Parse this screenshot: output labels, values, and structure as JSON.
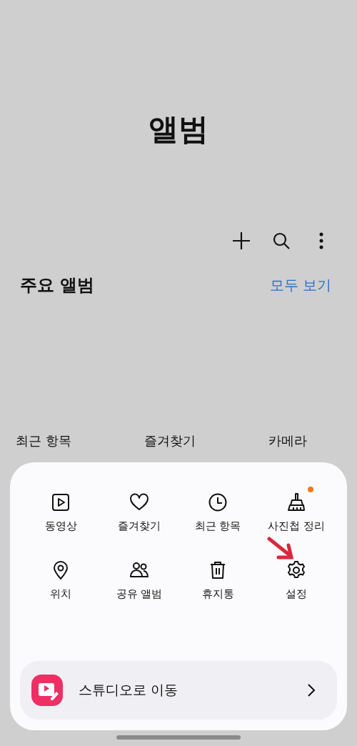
{
  "header": {
    "title": "앨범"
  },
  "toolbar": [
    {
      "kind": "add"
    },
    {
      "kind": "search"
    },
    {
      "kind": "more"
    }
  ],
  "section": {
    "title": "주요 앨범",
    "link": "모두 보기"
  },
  "albums": [
    "최근 항목",
    "즐겨찾기",
    "카메라"
  ],
  "menu": [
    {
      "label": "동영상",
      "kind": "video",
      "badge": false
    },
    {
      "label": "즐겨찾기",
      "kind": "heart",
      "badge": false
    },
    {
      "label": "최근 항목",
      "kind": "clock",
      "badge": false
    },
    {
      "label": "사진첩 정리",
      "kind": "broom",
      "badge": true
    },
    {
      "label": "위치",
      "kind": "pin",
      "badge": false
    },
    {
      "label": "공유 앨범",
      "kind": "people",
      "badge": false
    },
    {
      "label": "휴지통",
      "kind": "trash",
      "badge": false
    },
    {
      "label": "설정",
      "kind": "gear",
      "badge": false
    }
  ],
  "studio": {
    "label": "스튜디오로 이동"
  }
}
